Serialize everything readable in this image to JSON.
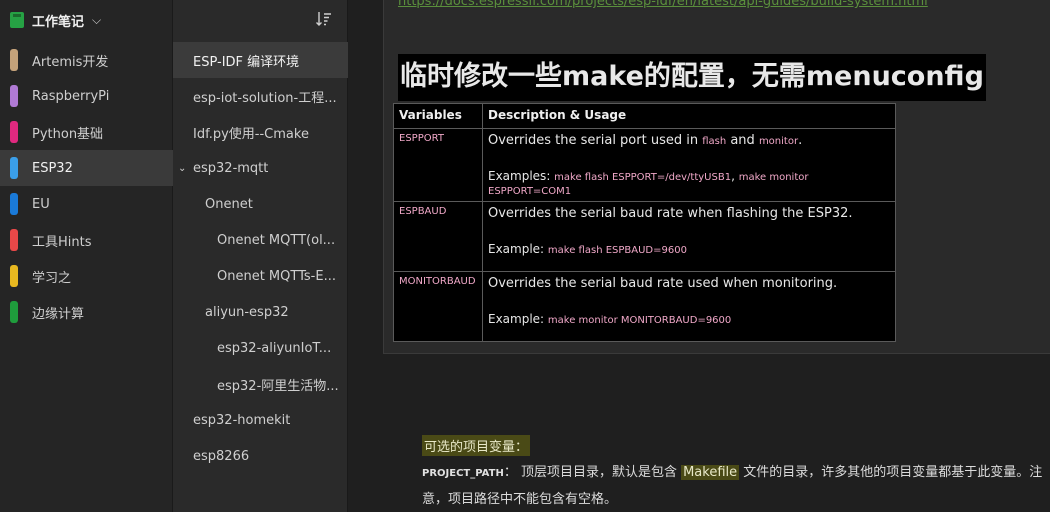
{
  "notebook": {
    "title": "工作笔记",
    "items": [
      {
        "label": "Artemis开发",
        "color": "#c4a27a"
      },
      {
        "label": "RaspberryPi",
        "color": "#b07ad4"
      },
      {
        "label": "Python基础",
        "color": "#e0297f"
      },
      {
        "label": "ESP32",
        "color": "#3a9ee8",
        "active": true
      },
      {
        "label": "EU",
        "color": "#1a7ad8"
      },
      {
        "label": "工具Hints",
        "color": "#e84848"
      },
      {
        "label": "学习之",
        "color": "#e8b820"
      },
      {
        "label": "边缘计算",
        "color": "#1f9c3c"
      }
    ]
  },
  "notes": [
    {
      "label": "ESP-IDF  编译环境",
      "indent": 0,
      "active": true
    },
    {
      "label": "esp-iot-solution-工程...",
      "indent": 0
    },
    {
      "label": "Idf.py使用--Cmake",
      "indent": 0
    },
    {
      "label": "esp32-mqtt",
      "indent": 0,
      "expanded": true
    },
    {
      "label": "Onenet",
      "indent": 1
    },
    {
      "label": "Onenet MQTT(ol...",
      "indent": 2
    },
    {
      "label": "Onenet MQTTs-E...",
      "indent": 2
    },
    {
      "label": "aliyun-esp32",
      "indent": 1
    },
    {
      "label": "esp32-aliyunIoT...",
      "indent": 2
    },
    {
      "label": "esp32-阿里生活物...",
      "indent": 2
    },
    {
      "label": "esp32-homekit",
      "indent": 0
    },
    {
      "label": "esp8266",
      "indent": 0
    }
  ],
  "content": {
    "top_link": "https://docs.espressif.com/projects/esp-idf/en/latest/api-guides/build-system.html",
    "heading": "临时修改一些make的配置，无需menuconfig",
    "table": {
      "headers": [
        "Variables",
        "Description & Usage"
      ],
      "rows": [
        {
          "name": "ESPPORT",
          "desc_pre": "Overrides the serial port used in ",
          "code1": "flash",
          "desc_mid": " and ",
          "code2": "monitor",
          "desc_post": ".",
          "ex_label": "Examples: ",
          "ex_code1": "make flash ESPPORT=/dev/ttyUSB1",
          "ex_sep": ", ",
          "ex_code2": "make monitor ESPPORT=COM1"
        },
        {
          "name": "ESPBAUD",
          "desc": "Overrides the serial baud rate when flashing the ESP32.",
          "ex_label": "Example: ",
          "ex_code1": "make flash ESPBAUD=9600"
        },
        {
          "name": "MONITORBAUD",
          "desc": "Overrides the serial baud rate used when monitoring.",
          "ex_label": "Example: ",
          "ex_code1": "make monitor MONITORBAUD=9600"
        }
      ]
    },
    "optional_label": "可选的项目变量：",
    "project_path_key": "PROJECT_PATH",
    "project_path_colon": "：",
    "project_path_text1": " 顶层项目目录，默认是包含 ",
    "project_path_hl": "Makefile",
    "project_path_text2": " 文件的目录，许多其他的项目变量都基于此变量。注意，项目路径中不能包含有空格。"
  }
}
